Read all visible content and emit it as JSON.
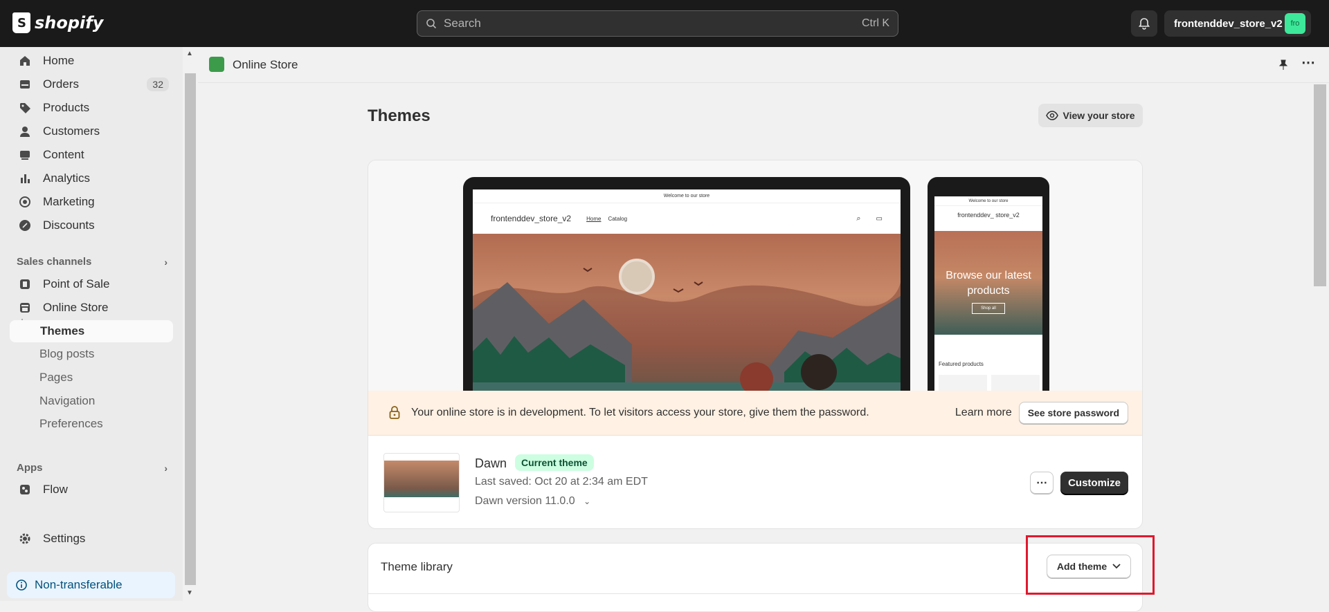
{
  "topbar": {
    "logo_text": "shopify",
    "search_placeholder": "Search",
    "search_shortcut": "Ctrl K",
    "account_name": "frontenddev_store_v2",
    "avatar_initials": "fro"
  },
  "sidebar": {
    "items": [
      {
        "label": "Home",
        "icon": "home-icon"
      },
      {
        "label": "Orders",
        "icon": "orders-icon",
        "badge": "32"
      },
      {
        "label": "Products",
        "icon": "tag-icon"
      },
      {
        "label": "Customers",
        "icon": "person-icon"
      },
      {
        "label": "Content",
        "icon": "content-icon"
      },
      {
        "label": "Analytics",
        "icon": "bar-chart-icon"
      },
      {
        "label": "Marketing",
        "icon": "target-icon"
      },
      {
        "label": "Discounts",
        "icon": "discount-icon"
      }
    ],
    "sales_channels_label": "Sales channels",
    "channels": [
      {
        "label": "Point of Sale",
        "icon": "pos-icon"
      },
      {
        "label": "Online Store",
        "icon": "store-icon"
      }
    ],
    "online_store_sub": [
      "Themes",
      "Blog posts",
      "Pages",
      "Navigation",
      "Preferences"
    ],
    "apps_label": "Apps",
    "apps": [
      {
        "label": "Flow",
        "icon": "flow-icon"
      }
    ],
    "settings_label": "Settings",
    "non_transferable": "Non-transferable"
  },
  "page_header": {
    "title": "Online Store"
  },
  "main": {
    "title": "Themes",
    "view_store": "View your store",
    "preview": {
      "announcement": "Welcome to our store",
      "store_name": "frontenddev_store_v2",
      "nav_home": "Home",
      "nav_catalog": "Catalog",
      "phone_store_name": "frontenddev_ store_v2",
      "phone_hero": "Browse our latest products",
      "phone_shop_all": "Shop all",
      "phone_featured": "Featured products"
    },
    "banner": {
      "message": "Your online store is in development. To let visitors access your store, give them the password.",
      "learn_more": "Learn more",
      "see_password": "See store password"
    },
    "current_theme": {
      "name": "Dawn",
      "badge": "Current theme",
      "last_saved": "Last saved: Oct 20 at 2:34 am EDT",
      "version": "Dawn version 11.0.0",
      "customize": "Customize"
    },
    "library": {
      "title": "Theme library",
      "add_theme": "Add theme"
    }
  },
  "colors": {
    "topbar": "#1a1a1a",
    "accent_badge": "#cdfee1",
    "highlight": "#e0182d"
  }
}
